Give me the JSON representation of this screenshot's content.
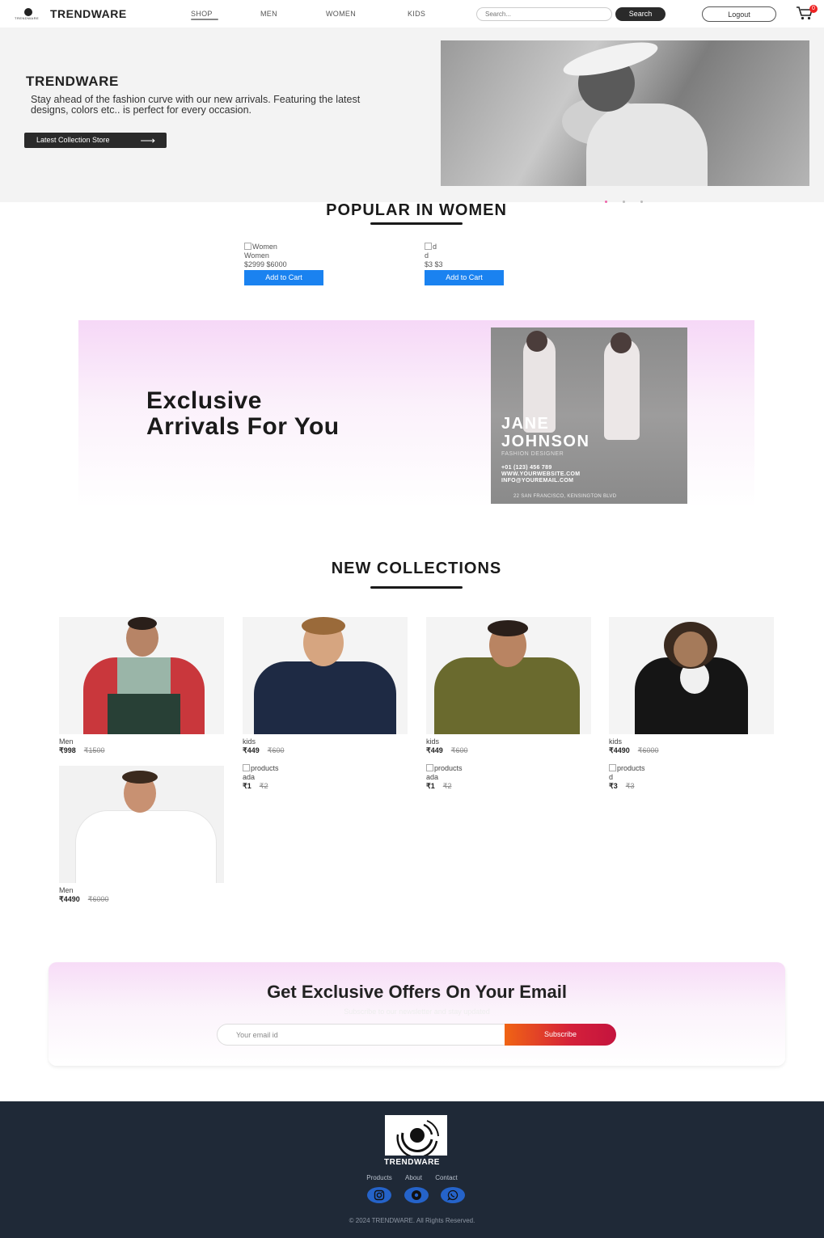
{
  "nav": {
    "logo_text": "TRENDWARE",
    "brand": "TRENDWARE",
    "links": [
      "SHOP",
      "MEN",
      "WOMEN",
      "KIDS"
    ],
    "search_placeholder": "Search...",
    "search_button": "Search",
    "logout_button": "Logout",
    "cart_count": "0"
  },
  "hero": {
    "title": "TRENDWARE",
    "description": "Stay ahead of the fashion curve with our new arrivals. Featuring the latest designs, colors etc.. is perfect for every occasion.",
    "button_label": "Latest Collection Store",
    "button_arrow": "⟶",
    "slides": 3,
    "active_slide": 0
  },
  "popular": {
    "title": "POPULAR IN WOMEN",
    "items": [
      {
        "img_alt": "Women",
        "name": "Women",
        "new_price": "$2999",
        "old_price": "$6000",
        "button": "Add to Cart"
      },
      {
        "img_alt": "d",
        "name": "d",
        "new_price": "$3",
        "old_price": "$3",
        "button": "Add to Cart"
      }
    ]
  },
  "exclusive": {
    "title_line1": "Exclusive",
    "title_line2": "Arrivals For You",
    "poster": {
      "name_line1": "JANE",
      "name_line2": "JOHNSON",
      "role": "FASHION DESIGNER",
      "phone": "+01 (123) 456 789",
      "website": "WWW.YOURWEBSITE.COM",
      "email": "INFO@YOUREMAIL.COM",
      "address": "22 SAN FRANCISCO, KENSINGTON BLVD"
    }
  },
  "collections": {
    "title": "NEW COLLECTIONS",
    "cards": [
      {
        "category": "Men",
        "new_price": "₹998",
        "old_price": "₹1500"
      },
      {
        "category": "kids",
        "new_price": "₹449",
        "old_price": "₹600"
      },
      {
        "category": "kids",
        "new_price": "₹449",
        "old_price": "₹600"
      },
      {
        "category": "kids",
        "new_price": "₹4490",
        "old_price": "₹6000"
      },
      {
        "category": "Men",
        "new_price": "₹4490",
        "old_price": "₹6000"
      }
    ],
    "alt_cards": [
      {
        "img_alt": "products",
        "name": "ada",
        "new_price": "₹1",
        "old_price": "₹2"
      },
      {
        "img_alt": "products",
        "name": "ada",
        "new_price": "₹1",
        "old_price": "₹2"
      },
      {
        "img_alt": "products",
        "name": "d",
        "new_price": "₹3",
        "old_price": "₹3"
      }
    ]
  },
  "newsletter": {
    "title": "Get Exclusive Offers On Your Email",
    "subtitle": "Subscribe to our newsletter and stay updated",
    "input_placeholder": "Your email id",
    "button": "Subscribe"
  },
  "footer": {
    "brand": "TRENDWARE",
    "links": [
      "Products",
      "About",
      "Contact"
    ],
    "social_icons": [
      "instagram-icon",
      "pinterest-icon",
      "whatsapp-icon"
    ],
    "copyright": "© 2024 TRENDWARE. All Rights Reserved."
  },
  "colors": {
    "footer_bg": "#1f2937",
    "add_to_cart": "#1a82f0",
    "subscribe_from": "#f06414",
    "subscribe_to": "#c4143e",
    "social_icon_bg": "#2563c9"
  }
}
